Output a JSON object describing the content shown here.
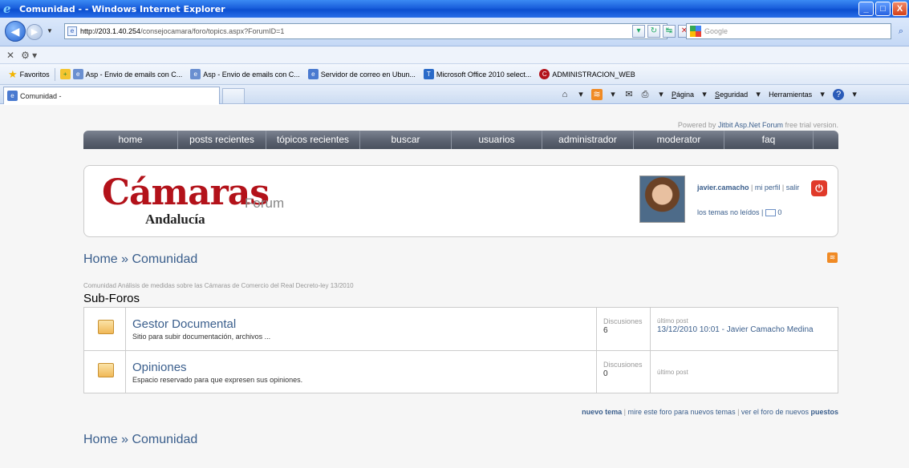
{
  "window": {
    "title": "Comunidad - - Windows Internet Explorer",
    "controls": {
      "minimize": "_",
      "maximize": "□",
      "close": "X"
    }
  },
  "address": {
    "url_host": "http://203.1.40.254",
    "url_path": "/consejocamara/foro/topics.aspx?ForumID=1",
    "search_placeholder": "Google"
  },
  "favorites": {
    "label": "Favoritos",
    "items": [
      {
        "label": "Asp - Envio de emails con C..."
      },
      {
        "label": "Asp - Envio de emails con C..."
      },
      {
        "label": "Servidor de correo en Ubun..."
      },
      {
        "label": "Microsoft Office 2010 select..."
      },
      {
        "label": "ADMINISTRACION_WEB"
      }
    ]
  },
  "tab": {
    "title": "Comunidad -",
    "tools": {
      "pagina": "Página",
      "seguridad": "Seguridad",
      "herramientas": "Herramientas"
    }
  },
  "page": {
    "powered_prefix": "Powered by ",
    "powered_link": "Jitbit Asp.Net Forum",
    "powered_suffix": " free trial version.",
    "nav": [
      {
        "label": "home"
      },
      {
        "label": "posts recientes"
      },
      {
        "label": "tópicos recientes"
      },
      {
        "label": "buscar"
      },
      {
        "label": "usuarios"
      },
      {
        "label": "administrador"
      },
      {
        "label": "moderator"
      },
      {
        "label": "faq"
      }
    ],
    "logo": {
      "main": "Cámaras",
      "sub": "Andalucía",
      "forum": "Forum"
    },
    "user": {
      "name": "javier.camacho",
      "separator": " | ",
      "profile": "mi perfil",
      "logout": "salir",
      "unread": "los temas no leídos",
      "messages": "0"
    },
    "breadcrumb": "Home » Comunidad",
    "description": "Comunidad Análisis de medidas sobre las Cámaras de Comercio del Real Decreto-ley 13/2010",
    "subforos": "Sub-Foros",
    "forums": [
      {
        "name": "Gestor Documental",
        "desc": "Sitio para subir documentación, archivos ...",
        "count_label": "Discusiones",
        "count": "6",
        "last_label": "último post",
        "last_post": "13/12/2010 10:01 - Javier Camacho Medina"
      },
      {
        "name": "Opiniones",
        "desc": "Espacio reservado para que expresen sus opiniones.",
        "count_label": "Discusiones",
        "count": "0",
        "last_label": "último post",
        "last_post": ""
      }
    ],
    "footer": {
      "new_topic": "nuevo tema",
      "watch": "mire este foro para nuevos temas",
      "new_posts_prefix": "ver el foro de nuevos ",
      "new_posts_bold": "puestos"
    }
  }
}
